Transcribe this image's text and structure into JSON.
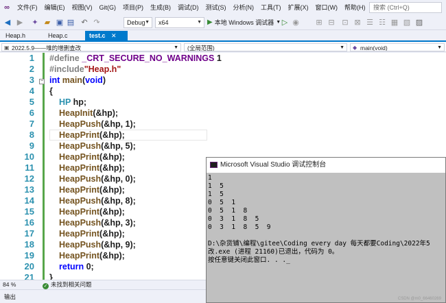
{
  "menu": {
    "items": [
      "文件(F)",
      "编辑(E)",
      "视图(V)",
      "Git(G)",
      "项目(P)",
      "生成(B)",
      "调试(D)",
      "测试(S)",
      "分析(N)",
      "工具(T)",
      "扩展(X)",
      "窗口(W)",
      "帮助(H)"
    ],
    "search_placeholder": "搜索 (Ctrl+Q)"
  },
  "toolbar": {
    "config": "Debug",
    "platform": "x64",
    "run_label": "本地 Windows 调试器"
  },
  "tabs": [
    {
      "label": "Heap.h",
      "active": false
    },
    {
      "label": "Heap.c",
      "active": false
    },
    {
      "label": "test.c",
      "active": true
    }
  ],
  "navbar": {
    "project": "2022.5.9——堆的增删查改",
    "scope": "(全局范围)",
    "member": "main(void)"
  },
  "code": {
    "line_numbers": [
      "1",
      "2",
      "3",
      "4",
      "5",
      "6",
      "7",
      "8",
      "9",
      "10",
      "11",
      "12",
      "13",
      "14",
      "15",
      "16",
      "17",
      "18",
      "19",
      "20",
      "21"
    ],
    "line1_pp": "#define ",
    "line1_macro": "_CRT_SECURE_NO_WARNINGS",
    "line1_val": " 1",
    "line2_pp": "#include",
    "line2_str": "\"Heap.h\"",
    "line3_kw": "int",
    "line3_fn": " main",
    "line3_paren_open": "(",
    "line3_void": "void",
    "line3_paren_close": ")",
    "line4": "{",
    "line5_type": "HP",
    "line5_rest": " hp;",
    "line6_fn": "HeapInit",
    "line6_rest": "(&hp);",
    "line7_fn": "HeapPush",
    "line7_rest": "(&hp, 1);",
    "line8_fn": "HeapPrint",
    "line8_rest": "(&hp);",
    "line9_fn": "HeapPush",
    "line9_rest": "(&hp, 5);",
    "line10_fn": "HeapPrint",
    "line10_rest": "(&hp);",
    "line11_fn": "HeapPrint",
    "line11_rest": "(&hp);",
    "line12_fn": "HeapPush",
    "line12_rest": "(&hp, 0);",
    "line13_fn": "HeapPrint",
    "line13_rest": "(&hp);",
    "line14_fn": "HeapPush",
    "line14_rest": "(&hp, 8);",
    "line15_fn": "HeapPrint",
    "line15_rest": "(&hp);",
    "line16_fn": "HeapPush",
    "line16_rest": "(&hp, 3);",
    "line17_fn": "HeapPrint",
    "line17_rest": "(&hp);",
    "line18_fn": "HeapPush",
    "line18_rest": "(&hp, 9);",
    "line19_fn": "HeapPrint",
    "line19_rest": "(&hp);",
    "line20_kw": "return",
    "line20_rest": " 0;",
    "line21": "}"
  },
  "status": {
    "zoom": "84 %",
    "issues": "未找到相关问题",
    "output_tab": "输出"
  },
  "console": {
    "title": "Microsoft Visual Studio 调试控制台",
    "lines": [
      "1",
      "1  5",
      "1  5",
      "0  5  1",
      "0  5  1  8",
      "0  3  1  8  5",
      "0  3  1  8  5  9",
      "",
      "D:\\杂货铺\\编程\\gitee\\Coding every day 每天都要Coding\\2022年5",
      "改.exe (进程 21160)已退出，代码为 0。",
      "按任意键关闭此窗口. . ."
    ],
    "watermark": "CSDN @m0_66460269"
  }
}
